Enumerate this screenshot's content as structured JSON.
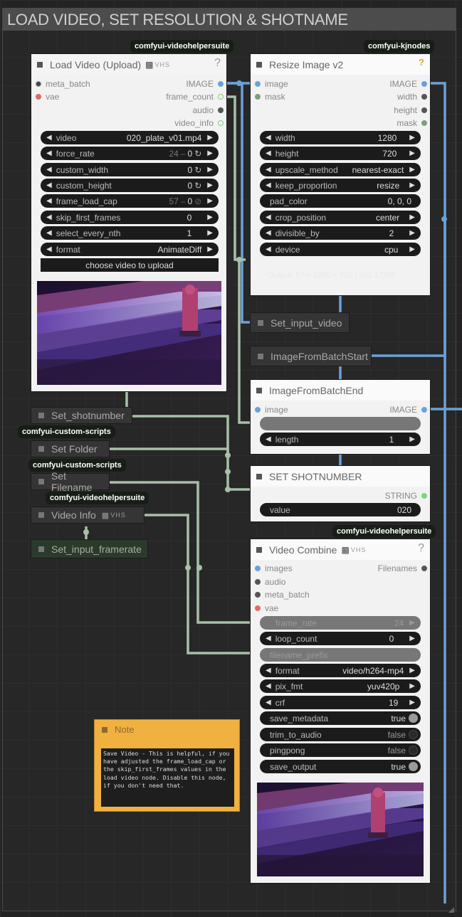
{
  "group": {
    "title": "LOAD VIDEO, SET RESOLUTION & SHOTNAME"
  },
  "badges": {
    "load_video": "comfyui-videohelpersuite",
    "resize": "comfyui-kjnodes",
    "set_shotnumber": "comfyui-custom-scripts",
    "set_folder": "comfyui-custom-scripts",
    "set_filename": "comfyui-videohelpersuite",
    "video_combine": "comfyui-videohelpersuite"
  },
  "load_video": {
    "title": "Load Video (Upload)",
    "help": "?",
    "vhs": "VHS",
    "inputs": [
      "meta_batch",
      "vae"
    ],
    "outputs": [
      "IMAGE",
      "frame_count",
      "audio",
      "video_info"
    ],
    "widgets": [
      {
        "label": "video",
        "value": "020_plate_v01.mp4"
      },
      {
        "label": "force_rate",
        "value": "24",
        "suffix": "0"
      },
      {
        "label": "custom_width",
        "value": "0"
      },
      {
        "label": "custom_height",
        "value": "0"
      },
      {
        "label": "frame_load_cap",
        "value": "57",
        "suffix": "0"
      },
      {
        "label": "skip_first_frames",
        "value": "0"
      },
      {
        "label": "select_every_nth",
        "value": "1"
      },
      {
        "label": "format",
        "value": "AnimateDiff"
      }
    ],
    "upload_button": "choose video to upload"
  },
  "resize": {
    "title": "Resize Image v2",
    "help": "?",
    "inputs": [
      "image",
      "mask"
    ],
    "outputs": [
      "IMAGE",
      "width",
      "height",
      "mask"
    ],
    "widgets": [
      {
        "label": "width",
        "value": "1280"
      },
      {
        "label": "height",
        "value": "720"
      },
      {
        "label": "upscale_method",
        "value": "nearest-exact"
      },
      {
        "label": "keep_proportion",
        "value": "resize"
      },
      {
        "label": "pad_color",
        "value": "0, 0, 0"
      },
      {
        "label": "crop_position",
        "value": "center"
      },
      {
        "label": "divisible_by",
        "value": "2"
      },
      {
        "label": "device",
        "value": "cpu"
      }
    ],
    "output_text": "Output: 57 × 1280 × 720 | 601.17MB"
  },
  "set_input_video": {
    "title": "Set_input_video"
  },
  "image_from_batch_start": {
    "title": "ImageFromBatchStart"
  },
  "image_from_batch_end": {
    "title": "ImageFromBatchEnd",
    "input": "image",
    "output": "IMAGE",
    "widgets": [
      {
        "label": "",
        "value": ""
      },
      {
        "label": "length",
        "value": "1"
      }
    ]
  },
  "set_shotnumber_node": {
    "title": "SET SHOTNUMBER",
    "output": "STRING",
    "widget": {
      "label": "value",
      "value": "020"
    }
  },
  "left_nodes": {
    "set_shotnumber": "Set_shotnumber",
    "set_folder": "Set Folder",
    "set_filename": "Set Filename",
    "video_info": "Video Info",
    "video_info_vhs": "VHS",
    "set_input_framerate": "Set_input_framerate"
  },
  "video_combine": {
    "title": "Video Combine",
    "help": "?",
    "vhs": "VHS",
    "inputs": [
      "images",
      "audio",
      "meta_batch",
      "vae"
    ],
    "output": "Filenames",
    "widgets": [
      {
        "label": "frame_rate",
        "value": "24"
      },
      {
        "label": "loop_count",
        "value": "0"
      },
      {
        "label": "filename_prefix",
        "value": ""
      },
      {
        "label": "format",
        "value": "video/h264-mp4"
      },
      {
        "label": "pix_fmt",
        "value": "yuv420p"
      },
      {
        "label": "crf",
        "value": "19"
      },
      {
        "label": "save_metadata",
        "value": "true"
      },
      {
        "label": "trim_to_audio",
        "value": "false"
      },
      {
        "label": "pingpong",
        "value": "false"
      },
      {
        "label": "save_output",
        "value": "true"
      }
    ]
  },
  "note": {
    "title": "Note",
    "text": "Save Video - This is helpful, if you have adjusted the frame_load_cap or the skip_first_frames values in the load video node. Disable this node, if you don't need that."
  },
  "colors": {
    "image_link": "#6aa2d8",
    "generic_link": "#a8bfa8",
    "note": "#f1b140",
    "node_light": "#f2f2f2",
    "node_dark": "#353535"
  }
}
